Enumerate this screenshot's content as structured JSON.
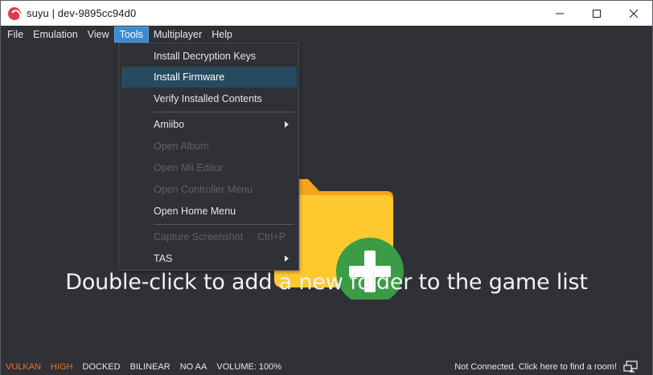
{
  "window": {
    "title": "suyu | dev-9895cc94d0"
  },
  "menubar": {
    "items": [
      "File",
      "Emulation",
      "View",
      "Tools",
      "Multiplayer",
      "Help"
    ],
    "active_index": 3
  },
  "tools_menu": {
    "install_keys": "Install Decryption Keys",
    "install_firmware": "Install Firmware",
    "verify_contents": "Verify Installed Contents",
    "amiibo": "Amiibo",
    "open_album": "Open Album",
    "open_mii_editor": "Open Mii Editor",
    "open_controller_menu": "Open Controller Menu",
    "open_home_menu": "Open Home Menu",
    "capture_screenshot": "Capture Screenshot",
    "capture_shortcut": "Ctrl+P",
    "tas": "TAS"
  },
  "main": {
    "empty_message": "Double-click to add a new folder to the game list",
    "folder_icon": "folder-add-icon"
  },
  "statusbar": {
    "renderer": "VULKAN",
    "accuracy": "HIGH",
    "mode": "DOCKED",
    "filter": "BILINEAR",
    "aa": "NO AA",
    "volume": "VOLUME: 100%",
    "network": "Not Connected. Click here to find a room!"
  },
  "colors": {
    "background": "#2f3136",
    "menu_highlight": "#264b60",
    "menubar_active": "#3b8bd1",
    "status_warn": "#e8732b",
    "folder_yellow": "#fdc92f",
    "folder_tab": "#f7a21b",
    "plus_green": "#3a9c45"
  }
}
